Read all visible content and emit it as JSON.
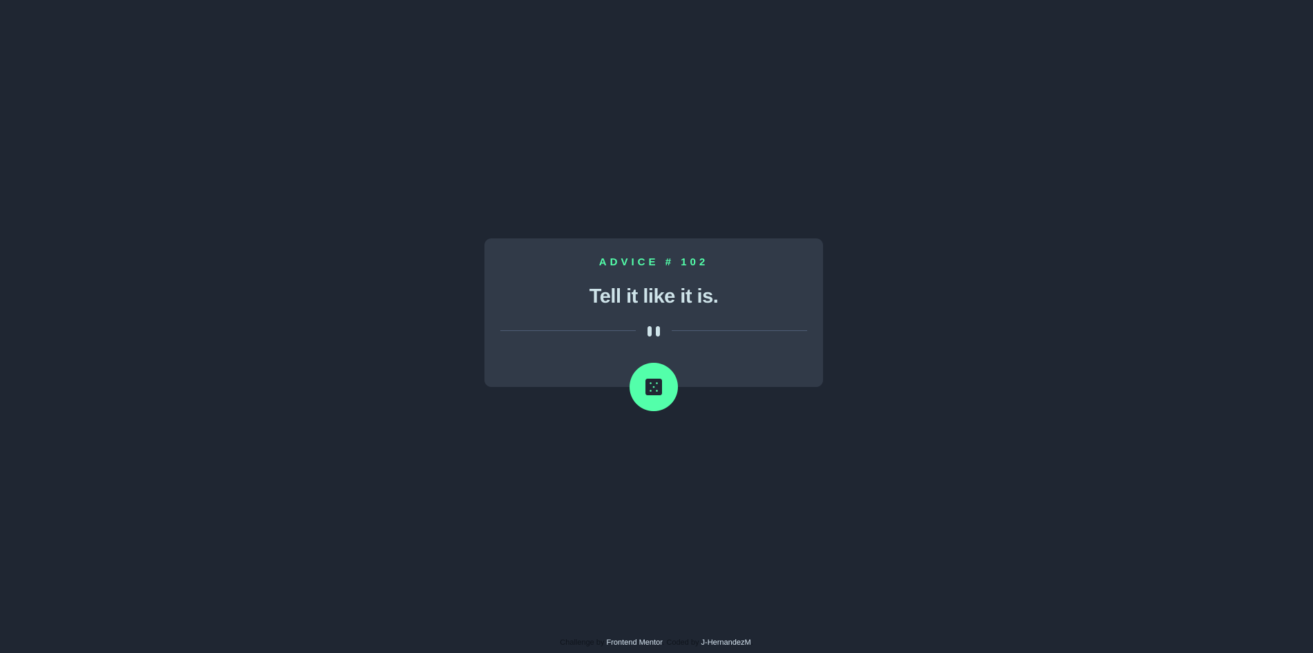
{
  "card": {
    "advice_id": "ADVICE # 102",
    "advice_text": "Tell it like it is."
  },
  "dice_button": {
    "icon": "dice-icon"
  },
  "divider": {
    "icon": "pause-icon"
  },
  "attribution": {
    "prefix": "Challenge by ",
    "challenge_link": "Frontend Mentor",
    "middle": ". Coded by ",
    "author_link": "J-HernandezM",
    "suffix": "."
  },
  "colors": {
    "background": "#1f2632",
    "card": "#313a48",
    "accent": "#53ffaa",
    "text": "#cee3e9",
    "divider": "#4f5d74"
  }
}
